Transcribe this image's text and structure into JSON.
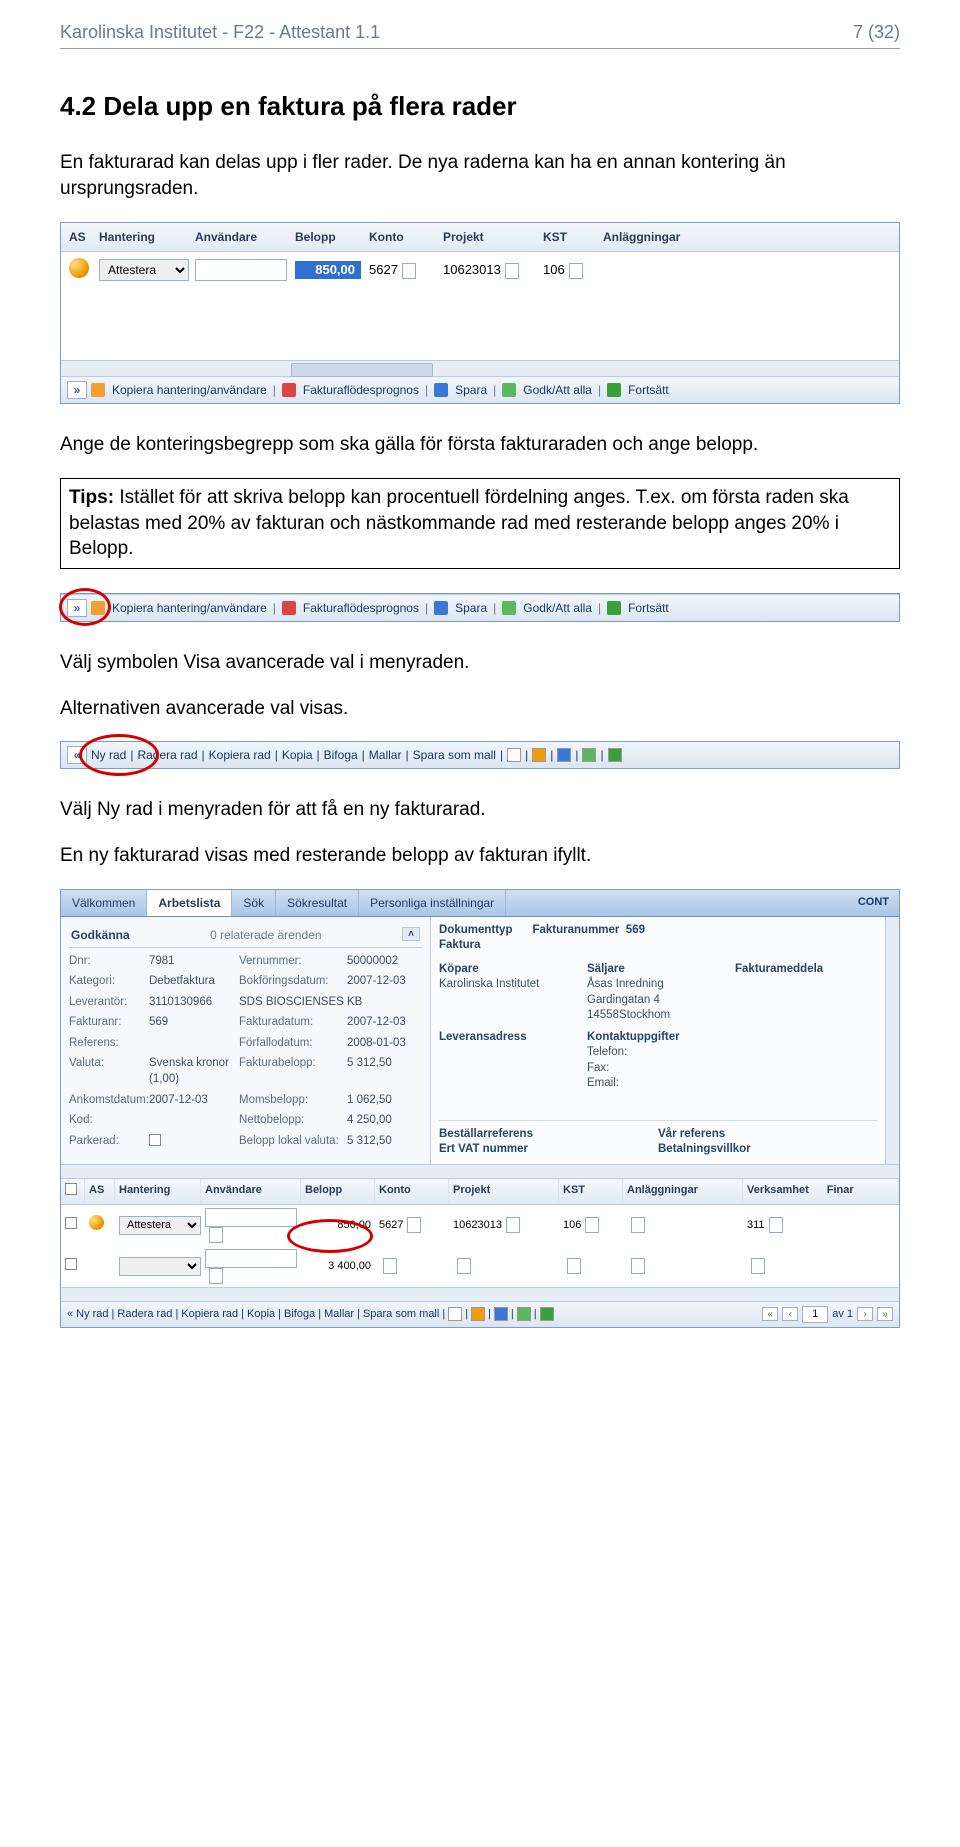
{
  "header": {
    "left": "Karolinska Institutet - F22 - Attestant 1.1",
    "right": "7 (32)"
  },
  "heading": "4.2  Dela upp en faktura på flera rader",
  "para1": "En fakturarad kan delas upp i fler rader. De nya raderna kan ha en annan kontering än ursprungsraden.",
  "panel1": {
    "cols": {
      "as": "AS",
      "hantering": "Hantering",
      "anvandare": "Användare",
      "belopp": "Belopp",
      "konto": "Konto",
      "projekt": "Projekt",
      "kst": "KST",
      "anlaggningar": "Anläggningar"
    },
    "row": {
      "hantering_value": "Attestera",
      "belopp": "850,00",
      "konto": "5627",
      "projekt": "10623013",
      "kst": "106"
    },
    "toolbar": {
      "expand": "»",
      "copy": "Kopiera hantering/användare",
      "prognos": "Fakturaflödesprognos",
      "spara": "Spara",
      "godk": "Godk/Att alla",
      "fortsatt": "Fortsätt"
    }
  },
  "para2": "Ange de konteringsbegrepp som ska gälla för första fakturaraden och ange belopp.",
  "tips": {
    "label": "Tips:",
    "text": " Istället för att skriva belopp kan procentuell fördelning anges. T.ex. om första raden ska belastas med 20% av fakturan och nästkommande rad med resterande belopp anges 20% i Belopp."
  },
  "para3": "Välj symbolen Visa avancerade val i menyraden.",
  "para4": "Alternativen avancerade val visas.",
  "panel3": {
    "expand": "«",
    "nyrad": "Ny rad",
    "radera": "Radera rad",
    "kopiera": "Kopiera rad",
    "kopia": "Kopia",
    "bifoga": "Bifoga",
    "mallar": "Mallar",
    "sparamall": "Spara som mall"
  },
  "para5": "Välj Ny rad i menyraden för att få en ny fakturarad.",
  "para6": "En ny fakturarad visas med resterande belopp av fakturan ifyllt.",
  "panel4": {
    "tabs": {
      "valkommen": "Välkommen",
      "arbetslista": "Arbetslista",
      "sok": "Sök",
      "sokresultat": "Sökresultat",
      "personliga": "Personliga inställningar"
    },
    "cont": "CONT",
    "godk_label": "Godkänna",
    "godk_count": "0 relaterade ärenden",
    "kv": {
      "dnr_l": "Dnr:",
      "dnr_v": "7981",
      "vernr_l": "Vernummer:",
      "vernr_v": "50000002",
      "kat_l": "Kategori:",
      "kat_v": "Debetfaktura",
      "bokd_l": "Bokföringsdatum:",
      "bokd_v": "2007-12-03",
      "lev_l": "Leverantör:",
      "lev_v": "3110130966",
      "levn_l": "",
      "levn_v": "SDS BIOSCIENSES KB",
      "fnr_l": "Fakturanr:",
      "fnr_v": "569",
      "fdat_l": "Fakturadatum:",
      "fdat_v": "2007-12-03",
      "ref_l": "Referens:",
      "forf_l": "Förfallodatum:",
      "forf_v": "2008-01-03",
      "val_l": "Valuta:",
      "val_v": "Svenska kronor (1,00)",
      "fbel_l": "Fakturabelopp:",
      "fbel_v": "5 312,50",
      "ank_l": "Ankomstdatum:",
      "ank_v": "2007-12-03",
      "mom_l": "Momsbelopp:",
      "mom_v": "1 062,50",
      "kod_l": "Kod:",
      "net_l": "Nettobelopp:",
      "net_v": "4 250,00",
      "park_l": "Parkerad:",
      "blv_l": "Belopp lokal valuta:",
      "blv_v": "5 312,50"
    },
    "right": {
      "doktyp_l": "Dokumenttyp",
      "doktyp_v": "Faktura",
      "faknr_l": "Fakturanummer",
      "faknr_v": "569",
      "kopare_l": "Köpare",
      "kopare_v": "Karolinska Institutet",
      "salj_l": "Säljare",
      "salj_v1": "Åsas Inredning",
      "salj_v2": "Gardingatan 4",
      "salj_v3": "14558Stockhom",
      "fmed_l": "Fakturameddela",
      "levadr_l": "Leveransadress",
      "kont_l": "Kontaktuppgifter",
      "tel": "Telefon:",
      "fax": "Fax:",
      "email": "Email:",
      "best_l": "Beställarreferens",
      "vat_l": "Ert VAT nummer",
      "var_l": "Vår referens",
      "bet_l": "Betalningsvillkor"
    },
    "gridcols": {
      "as": "AS",
      "hant": "Hantering",
      "anv": "Användare",
      "bel": "Belopp",
      "konto": "Konto",
      "projekt": "Projekt",
      "kst": "KST",
      "anl": "Anläggningar",
      "verk": "Verksamhet",
      "finar": "Finar"
    },
    "rows": [
      {
        "hant": "Attestera",
        "bel": "850,00",
        "konto": "5627",
        "projekt": "10623013",
        "kst": "106",
        "verk": "311"
      },
      {
        "hant": "",
        "bel": "3 400,00",
        "konto": "",
        "projekt": "",
        "kst": "",
        "verk": ""
      }
    ],
    "foot": {
      "expand": "«",
      "nyrad": "Ny rad",
      "radera": "Radera rad",
      "kopiera": "Kopiera rad",
      "kopia": "Kopia",
      "bifoga": "Bifoga",
      "mallar": "Mallar",
      "sparamall": "Spara som mall",
      "page": "1",
      "pagetotal": "av 1"
    }
  }
}
